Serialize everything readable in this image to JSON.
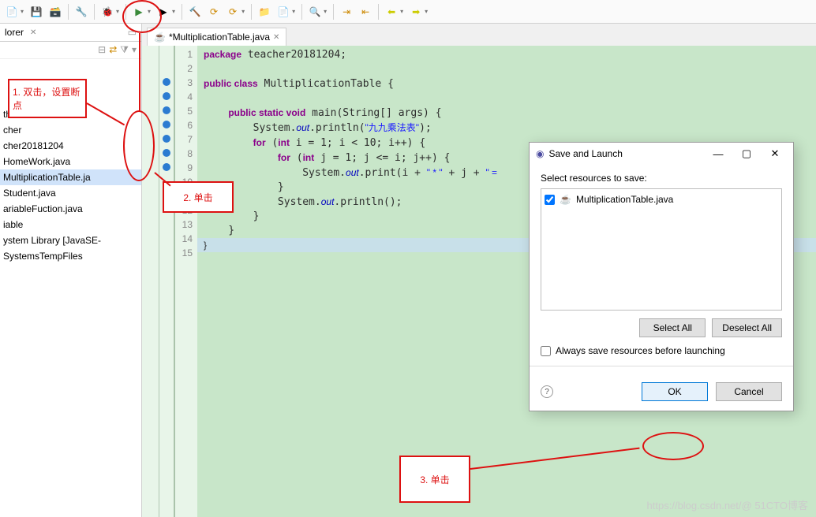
{
  "toolbar_icons": [
    "new",
    "save",
    "open",
    "undo",
    "redo",
    "debug",
    "run",
    "ext-tools",
    "build",
    "build-proj",
    "fold1",
    "fold2",
    "debug-last",
    "run-last",
    "breakpoint",
    "skip",
    "nav-back",
    "nav-fwd"
  ],
  "explorer": {
    "title": "lorer",
    "items": [
      "thod",
      "cher",
      "cher20181204",
      "HomeWork.java",
      "MultiplicationTable.ja",
      "Student.java",
      "ariableFuction.java",
      "iable",
      "ystem Library [JavaSE-",
      "SystemsTempFiles"
    ],
    "selected_index": 4
  },
  "editor": {
    "tab_label": "*MultiplicationTable.java",
    "line_start": 1,
    "line_end": 15,
    "breakpoints": [
      3,
      4,
      5,
      6,
      7,
      8,
      9
    ],
    "code_lines": {
      "l1": {
        "pre": "",
        "kw": "package",
        "rest": " teacher20181204;"
      },
      "l3a": "public class",
      "l3b": " MultiplicationTable {",
      "l5a": "    public static void",
      "l5b": " main(String[] args) {",
      "l6": "        System.out.println(\"九九乘法表\");",
      "l7": "        for (int i = 1; i < 10; i++) {",
      "l8": "            for (int j = 1; j <= i; j++) {",
      "l9": "                System.out.print(i + \" * \" + j + \" = ",
      "l10": "            }",
      "l11": "            System.out.println();",
      "l12": "        }",
      "l13": "    }",
      "l14": "}"
    }
  },
  "dialog": {
    "title": "Save and Launch",
    "prompt": "Select resources to save:",
    "item": "MultiplicationTable.java",
    "select_all": "Select All",
    "deselect_all": "Deselect All",
    "always": "Always save resources before launching",
    "ok": "OK",
    "cancel": "Cancel"
  },
  "annotations": {
    "a1": "1. 双击，设置断点",
    "a2": "2. 单击",
    "a3": "3. 单击"
  },
  "watermark": "https://blog.csdn.net/@ 51CTO博客"
}
